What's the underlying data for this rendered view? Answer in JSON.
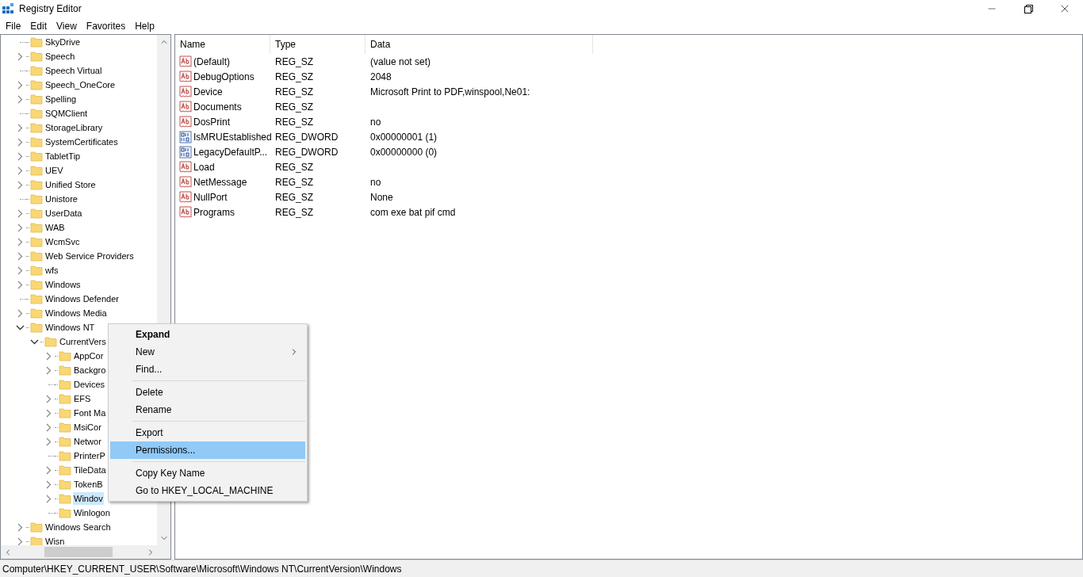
{
  "window": {
    "title": "Registry Editor"
  },
  "menu_bar": [
    "File",
    "Edit",
    "View",
    "Favorites",
    "Help"
  ],
  "tree": {
    "items": [
      {
        "name": "SkyDrive",
        "expandable": false,
        "selected": false
      },
      {
        "name": "Speech",
        "expandable": true,
        "expanded": false,
        "selected": false
      },
      {
        "name": "Speech Virtual",
        "expandable": false,
        "selected": false
      },
      {
        "name": "Speech_OneCore",
        "expandable": true,
        "expanded": false,
        "selected": false
      },
      {
        "name": "Spelling",
        "expandable": true,
        "expanded": false,
        "selected": false
      },
      {
        "name": "SQMClient",
        "expandable": false,
        "selected": false
      },
      {
        "name": "StorageLibrary",
        "expandable": true,
        "expanded": false,
        "selected": false
      },
      {
        "name": "SystemCertificates",
        "expandable": true,
        "expanded": false,
        "selected": false
      },
      {
        "name": "TabletTip",
        "expandable": true,
        "expanded": false,
        "selected": false
      },
      {
        "name": "UEV",
        "expandable": true,
        "expanded": false,
        "selected": false
      },
      {
        "name": "Unified Store",
        "expandable": true,
        "expanded": false,
        "selected": false
      },
      {
        "name": "Unistore",
        "expandable": false,
        "selected": false
      },
      {
        "name": "UserData",
        "expandable": true,
        "expanded": false,
        "selected": false
      },
      {
        "name": "WAB",
        "expandable": true,
        "expanded": false,
        "selected": false
      },
      {
        "name": "WcmSvc",
        "expandable": true,
        "expanded": false,
        "selected": false
      },
      {
        "name": "Web Service Providers",
        "expandable": true,
        "expanded": false,
        "selected": false
      },
      {
        "name": "wfs",
        "expandable": true,
        "expanded": false,
        "selected": false
      },
      {
        "name": "Windows",
        "expandable": true,
        "expanded": false,
        "selected": false
      },
      {
        "name": "Windows Defender",
        "expandable": false,
        "selected": false
      },
      {
        "name": "Windows Media",
        "expandable": true,
        "expanded": false,
        "selected": false
      },
      {
        "name": "Windows NT",
        "expandable": true,
        "expanded": true,
        "selected": false,
        "children": [
          {
            "name": "CurrentVers",
            "expandable": true,
            "expanded": true,
            "selected": false,
            "children": [
              {
                "name": "AppCor",
                "expandable": true,
                "expanded": false,
                "selected": false
              },
              {
                "name": "Backgro",
                "expandable": true,
                "expanded": false,
                "selected": false
              },
              {
                "name": "Devices",
                "expandable": false,
                "selected": false
              },
              {
                "name": "EFS",
                "expandable": true,
                "expanded": false,
                "selected": false
              },
              {
                "name": "Font Ma",
                "expandable": true,
                "expanded": false,
                "selected": false
              },
              {
                "name": "MsiCor",
                "expandable": true,
                "expanded": false,
                "selected": false
              },
              {
                "name": "Networ",
                "expandable": true,
                "expanded": false,
                "selected": false
              },
              {
                "name": "PrinterP",
                "expandable": false,
                "selected": false
              },
              {
                "name": "TileData",
                "expandable": true,
                "expanded": false,
                "selected": false
              },
              {
                "name": "TokenB",
                "expandable": true,
                "expanded": false,
                "selected": false
              },
              {
                "name": "Windov",
                "expandable": true,
                "expanded": false,
                "selected": true
              },
              {
                "name": "Winlogon",
                "expandable": false,
                "selected": false
              }
            ]
          }
        ]
      },
      {
        "name": "Windows Search",
        "expandable": true,
        "expanded": false,
        "selected": false
      },
      {
        "name": "Wisn",
        "expandable": true,
        "expanded": false,
        "selected": false
      }
    ]
  },
  "values": {
    "columns": [
      "Name",
      "Type",
      "Data"
    ],
    "rows": [
      {
        "name": "(Default)",
        "type": "REG_SZ",
        "data": "(value not set)",
        "kind": "string"
      },
      {
        "name": "DebugOptions",
        "type": "REG_SZ",
        "data": "2048",
        "kind": "string"
      },
      {
        "name": "Device",
        "type": "REG_SZ",
        "data": "Microsoft Print to PDF,winspool,Ne01:",
        "kind": "string"
      },
      {
        "name": "Documents",
        "type": "REG_SZ",
        "kind": "string"
      },
      {
        "name": "DosPrint",
        "type": "REG_SZ",
        "data": "no",
        "kind": "string"
      },
      {
        "name": "IsMRUEstablished",
        "type": "REG_DWORD",
        "data": "0x00000001 (1)",
        "kind": "binary"
      },
      {
        "name": "LegacyDefaultP...",
        "type": "REG_DWORD",
        "data": "0x00000000 (0)",
        "kind": "binary"
      },
      {
        "name": "Load",
        "type": "REG_SZ",
        "kind": "string"
      },
      {
        "name": "NetMessage",
        "type": "REG_SZ",
        "data": "no",
        "kind": "string"
      },
      {
        "name": "NullPort",
        "type": "REG_SZ",
        "data": "None",
        "kind": "string"
      },
      {
        "name": "Programs",
        "type": "REG_SZ",
        "data": "com exe bat pif cmd",
        "kind": "string"
      }
    ]
  },
  "context_menu": {
    "items": [
      {
        "kind": "item",
        "label": "Expand",
        "bold": true,
        "submenu": false,
        "selected": false
      },
      {
        "kind": "item",
        "label": "New",
        "bold": false,
        "submenu": true,
        "selected": false
      },
      {
        "kind": "item",
        "label": "Find...",
        "bold": false,
        "submenu": false,
        "selected": false
      },
      {
        "kind": "separator"
      },
      {
        "kind": "item",
        "label": "Delete",
        "bold": false,
        "submenu": false,
        "selected": false
      },
      {
        "kind": "item",
        "label": "Rename",
        "bold": false,
        "submenu": false,
        "selected": false
      },
      {
        "kind": "separator"
      },
      {
        "kind": "item",
        "label": "Export",
        "bold": false,
        "submenu": false,
        "selected": false
      },
      {
        "kind": "item",
        "label": "Permissions...",
        "bold": false,
        "submenu": false,
        "selected": true
      },
      {
        "kind": "separator"
      },
      {
        "kind": "item",
        "label": "Copy Key Name",
        "bold": false,
        "submenu": false,
        "selected": false
      },
      {
        "kind": "item",
        "label": "Go to HKEY_LOCAL_MACHINE",
        "bold": false,
        "submenu": false,
        "selected": false
      }
    ]
  },
  "status_bar": "Computer\\HKEY_CURRENT_USER\\Software\\Microsoft\\Windows NT\\CurrentVersion\\Windows"
}
